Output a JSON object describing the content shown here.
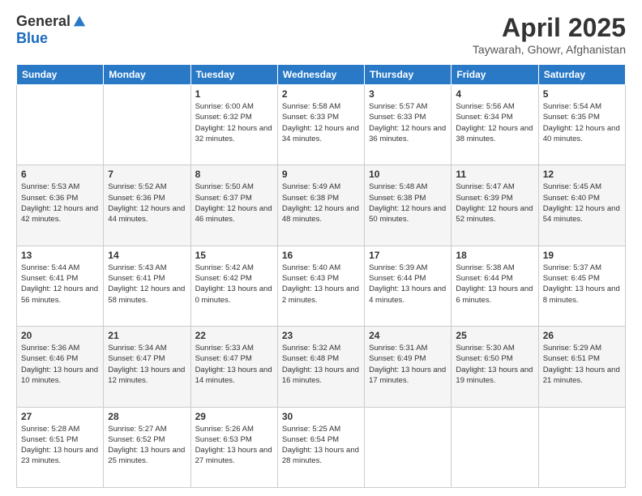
{
  "header": {
    "logo_general": "General",
    "logo_blue": "Blue",
    "title": "April 2025",
    "location": "Taywarah, Ghowr, Afghanistan"
  },
  "weekdays": [
    "Sunday",
    "Monday",
    "Tuesday",
    "Wednesday",
    "Thursday",
    "Friday",
    "Saturday"
  ],
  "weeks": [
    [
      {
        "day": null
      },
      {
        "day": null
      },
      {
        "day": "1",
        "sunrise": "6:00 AM",
        "sunset": "6:32 PM",
        "daylight": "12 hours and 32 minutes."
      },
      {
        "day": "2",
        "sunrise": "5:58 AM",
        "sunset": "6:33 PM",
        "daylight": "12 hours and 34 minutes."
      },
      {
        "day": "3",
        "sunrise": "5:57 AM",
        "sunset": "6:33 PM",
        "daylight": "12 hours and 36 minutes."
      },
      {
        "day": "4",
        "sunrise": "5:56 AM",
        "sunset": "6:34 PM",
        "daylight": "12 hours and 38 minutes."
      },
      {
        "day": "5",
        "sunrise": "5:54 AM",
        "sunset": "6:35 PM",
        "daylight": "12 hours and 40 minutes."
      }
    ],
    [
      {
        "day": "6",
        "sunrise": "5:53 AM",
        "sunset": "6:36 PM",
        "daylight": "12 hours and 42 minutes."
      },
      {
        "day": "7",
        "sunrise": "5:52 AM",
        "sunset": "6:36 PM",
        "daylight": "12 hours and 44 minutes."
      },
      {
        "day": "8",
        "sunrise": "5:50 AM",
        "sunset": "6:37 PM",
        "daylight": "12 hours and 46 minutes."
      },
      {
        "day": "9",
        "sunrise": "5:49 AM",
        "sunset": "6:38 PM",
        "daylight": "12 hours and 48 minutes."
      },
      {
        "day": "10",
        "sunrise": "5:48 AM",
        "sunset": "6:38 PM",
        "daylight": "12 hours and 50 minutes."
      },
      {
        "day": "11",
        "sunrise": "5:47 AM",
        "sunset": "6:39 PM",
        "daylight": "12 hours and 52 minutes."
      },
      {
        "day": "12",
        "sunrise": "5:45 AM",
        "sunset": "6:40 PM",
        "daylight": "12 hours and 54 minutes."
      }
    ],
    [
      {
        "day": "13",
        "sunrise": "5:44 AM",
        "sunset": "6:41 PM",
        "daylight": "12 hours and 56 minutes."
      },
      {
        "day": "14",
        "sunrise": "5:43 AM",
        "sunset": "6:41 PM",
        "daylight": "12 hours and 58 minutes."
      },
      {
        "day": "15",
        "sunrise": "5:42 AM",
        "sunset": "6:42 PM",
        "daylight": "13 hours and 0 minutes."
      },
      {
        "day": "16",
        "sunrise": "5:40 AM",
        "sunset": "6:43 PM",
        "daylight": "13 hours and 2 minutes."
      },
      {
        "day": "17",
        "sunrise": "5:39 AM",
        "sunset": "6:44 PM",
        "daylight": "13 hours and 4 minutes."
      },
      {
        "day": "18",
        "sunrise": "5:38 AM",
        "sunset": "6:44 PM",
        "daylight": "13 hours and 6 minutes."
      },
      {
        "day": "19",
        "sunrise": "5:37 AM",
        "sunset": "6:45 PM",
        "daylight": "13 hours and 8 minutes."
      }
    ],
    [
      {
        "day": "20",
        "sunrise": "5:36 AM",
        "sunset": "6:46 PM",
        "daylight": "13 hours and 10 minutes."
      },
      {
        "day": "21",
        "sunrise": "5:34 AM",
        "sunset": "6:47 PM",
        "daylight": "13 hours and 12 minutes."
      },
      {
        "day": "22",
        "sunrise": "5:33 AM",
        "sunset": "6:47 PM",
        "daylight": "13 hours and 14 minutes."
      },
      {
        "day": "23",
        "sunrise": "5:32 AM",
        "sunset": "6:48 PM",
        "daylight": "13 hours and 16 minutes."
      },
      {
        "day": "24",
        "sunrise": "5:31 AM",
        "sunset": "6:49 PM",
        "daylight": "13 hours and 17 minutes."
      },
      {
        "day": "25",
        "sunrise": "5:30 AM",
        "sunset": "6:50 PM",
        "daylight": "13 hours and 19 minutes."
      },
      {
        "day": "26",
        "sunrise": "5:29 AM",
        "sunset": "6:51 PM",
        "daylight": "13 hours and 21 minutes."
      }
    ],
    [
      {
        "day": "27",
        "sunrise": "5:28 AM",
        "sunset": "6:51 PM",
        "daylight": "13 hours and 23 minutes."
      },
      {
        "day": "28",
        "sunrise": "5:27 AM",
        "sunset": "6:52 PM",
        "daylight": "13 hours and 25 minutes."
      },
      {
        "day": "29",
        "sunrise": "5:26 AM",
        "sunset": "6:53 PM",
        "daylight": "13 hours and 27 minutes."
      },
      {
        "day": "30",
        "sunrise": "5:25 AM",
        "sunset": "6:54 PM",
        "daylight": "13 hours and 28 minutes."
      },
      {
        "day": null
      },
      {
        "day": null
      },
      {
        "day": null
      }
    ]
  ],
  "labels": {
    "sunrise_prefix": "Sunrise: ",
    "sunset_prefix": "Sunset: ",
    "daylight_prefix": "Daylight: "
  }
}
